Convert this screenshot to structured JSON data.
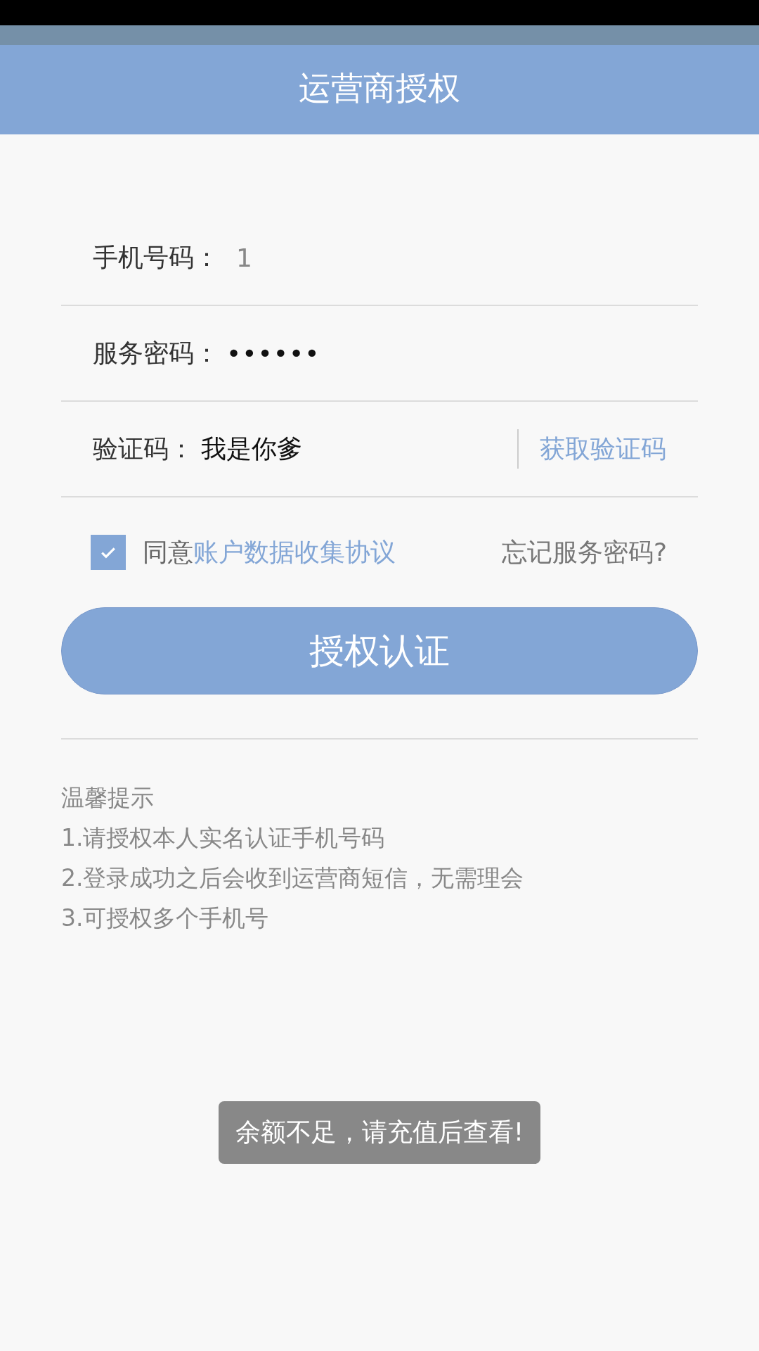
{
  "header": {
    "title": "运营商授权"
  },
  "fields": [
    {
      "label": "手机号码：",
      "value": "1",
      "kind": "text"
    },
    {
      "label": "服务密码：",
      "value": "••••••",
      "kind": "password"
    },
    {
      "label": "验证码：",
      "value": "我是你爹",
      "kind": "code",
      "action": "获取验证码"
    }
  ],
  "agreement": {
    "checked": true,
    "text": "同意",
    "link": "账户数据收集协议",
    "forgot": "忘记服务密码?"
  },
  "submit": "授权认证",
  "tips": {
    "title": "温馨提示",
    "items": [
      "1.请授权本人实名认证手机号码",
      "2.登录成功之后会收到运营商短信，无需理会",
      "3.可授权多个手机号"
    ]
  },
  "toast": "余额不足，请充值后查看!"
}
